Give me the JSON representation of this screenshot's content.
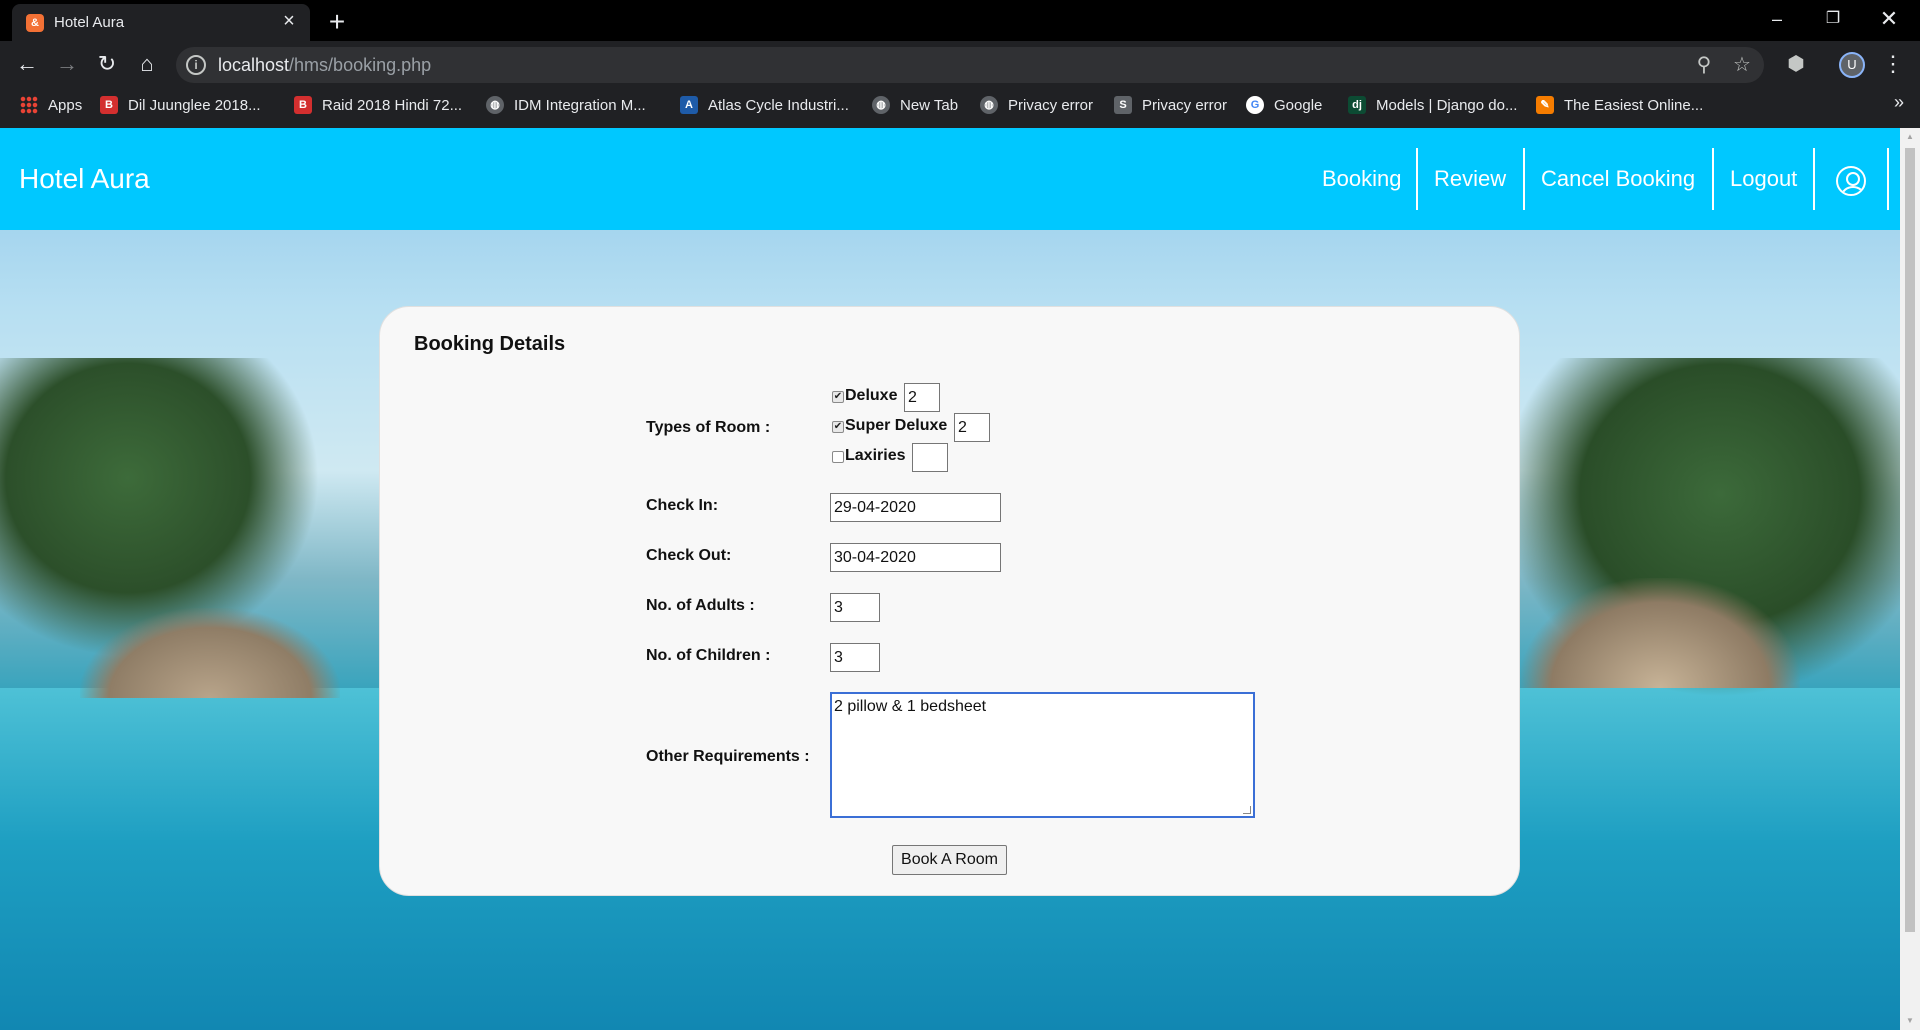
{
  "browser": {
    "tab_title": "Hotel Aura",
    "tab_favicon_glyph": "&",
    "url_host": "localhost",
    "url_path": "/hms/booking.php",
    "profile_initial": "U",
    "bookmarks": [
      {
        "label": "Apps",
        "icon": "apps-grid-icon"
      },
      {
        "label": "Dil Juunglee 2018...",
        "icon": "bigflix-icon",
        "color": "#d32f2f"
      },
      {
        "label": "Raid 2018 Hindi 72...",
        "icon": "bigflix-icon",
        "color": "#d32f2f"
      },
      {
        "label": "IDM Integration M...",
        "icon": "globe-icon",
        "color": "#5f6368"
      },
      {
        "label": "Atlas Cycle Industri...",
        "icon": "atlas-icon",
        "color": "#1e5ba8"
      },
      {
        "label": "New Tab",
        "icon": "globe-icon",
        "color": "#5f6368"
      },
      {
        "label": "Privacy error",
        "icon": "globe-icon",
        "color": "#5f6368"
      },
      {
        "label": "Privacy error",
        "icon": "sbi-icon",
        "color": "#5f6368"
      },
      {
        "label": "Google",
        "icon": "google-icon",
        "color": "#4285f4"
      },
      {
        "label": "Models | Django do...",
        "icon": "django-icon",
        "color": "#0c4b33"
      },
      {
        "label": "The Easiest Online...",
        "icon": "orange-app-icon",
        "color": "#f57c00"
      }
    ]
  },
  "site": {
    "brand": "Hotel Aura",
    "nav": [
      "Booking",
      "Review",
      "Cancel Booking",
      "Logout"
    ],
    "accent_color": "#00c8ff"
  },
  "form": {
    "title": "Booking Details",
    "room_types_label": "Types of Room :",
    "rooms": [
      {
        "label": "Deluxe",
        "checked": true,
        "qty": "2"
      },
      {
        "label": "Super Deluxe",
        "checked": true,
        "qty": "2"
      },
      {
        "label": "Laxiries",
        "checked": false,
        "qty": ""
      }
    ],
    "check_in_label": "Check In:",
    "check_in_value": "29-04-2020",
    "check_out_label": "Check Out:",
    "check_out_value": "30-04-2020",
    "adults_label": "No. of Adults :",
    "adults_value": "3",
    "children_label": "No. of Children :",
    "children_value": "3",
    "requirements_label": "Other Requirements :",
    "requirements_value": "2 pillow & 1 bedsheet",
    "submit_label": "Book A Room"
  }
}
